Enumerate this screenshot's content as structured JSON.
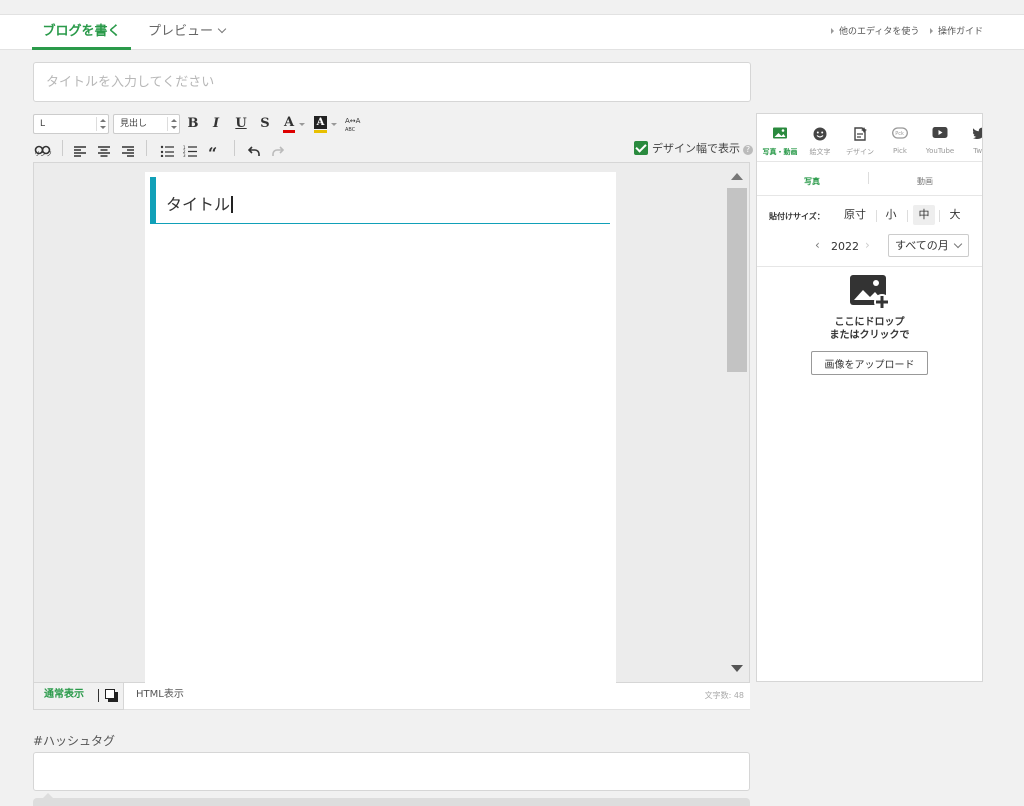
{
  "topnav": {
    "write_tab": "ブログを書く",
    "preview_tab": "プレビュー",
    "other_editor_link": "他のエディタを使う",
    "guide_link": "操作ガイド"
  },
  "title_input": {
    "placeholder": "タイトルを入力してください",
    "value": ""
  },
  "toolbar": {
    "font_size": "L",
    "heading_select": "見出し",
    "bold": "B",
    "italic": "I",
    "underline": "U",
    "strike": "S",
    "text_color": "A",
    "bg_color": "A",
    "link_label": "リンク",
    "design_width_label": "デザイン幅で表示",
    "design_width_checked": true,
    "accent": "#2a9a4a"
  },
  "editor": {
    "heading_text": "タイトル",
    "heading_color": "#11a0b8"
  },
  "editor_footer": {
    "normal_mode": "通常表示",
    "html_mode": "HTML表示",
    "char_count": "文字数: 48"
  },
  "hashtag": {
    "label": "#ハッシュタグ",
    "value": ""
  },
  "side": {
    "tabs": [
      {
        "label": "写真・動画",
        "icon": "photo-icon"
      },
      {
        "label": "絵文字",
        "icon": "emoji-icon"
      },
      {
        "label": "デザイン",
        "icon": "design-icon"
      },
      {
        "label": "Pick",
        "icon": "pick-icon"
      },
      {
        "label": "YouTube",
        "icon": "youtube-icon"
      },
      {
        "label": "Twit",
        "icon": "twitter-icon"
      }
    ],
    "sub_photo": "写真",
    "sub_video": "動画",
    "paste_size_label": "貼付けサイズ：",
    "sizes": [
      "原寸",
      "小",
      "中",
      "大"
    ],
    "selected_size": "中",
    "year": "2022",
    "month_select": "すべての月",
    "drop_text_line1": "ここにドロップ",
    "drop_text_line2": "またはクリックで",
    "upload_button": "画像をアップロード"
  }
}
